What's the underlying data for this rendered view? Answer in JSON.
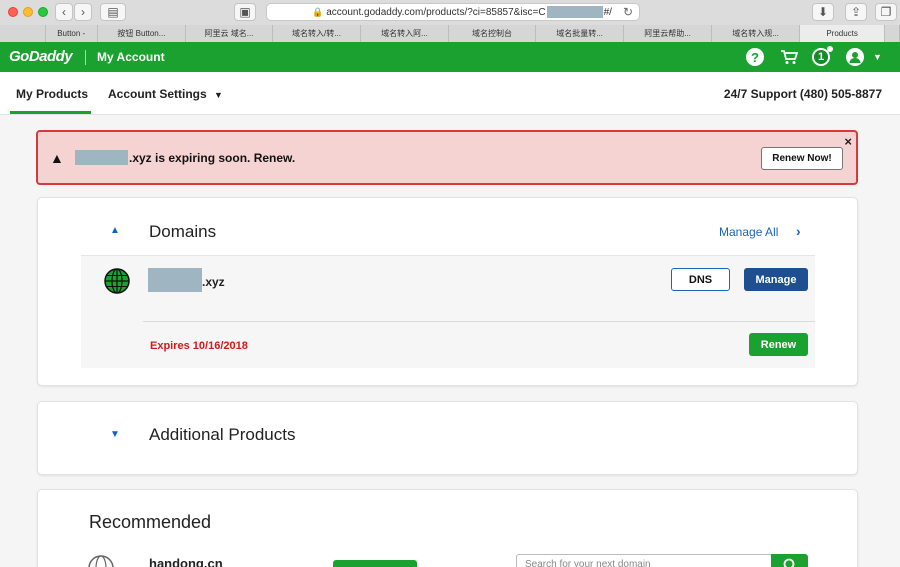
{
  "browser": {
    "url_prefix": "account.godaddy.com/products/?ci=85857&isc=C",
    "url_suffix": "#/",
    "tabs": [
      {
        "label": "",
        "active": false
      },
      {
        "label": "Button -",
        "active": false
      },
      {
        "label": "按钮 Button...",
        "active": false
      },
      {
        "label": "阿里云 域名...",
        "active": false
      },
      {
        "label": "域名转入/转...",
        "active": false
      },
      {
        "label": "域名转入阿...",
        "active": false
      },
      {
        "label": "域名控制台",
        "active": false
      },
      {
        "label": "域名批量转...",
        "active": false
      },
      {
        "label": "阿里云帮助...",
        "active": false
      },
      {
        "label": "域名转入规...",
        "active": false
      },
      {
        "label": "Products",
        "active": true
      },
      {
        "label": "",
        "active": false
      }
    ]
  },
  "header": {
    "logo": "GoDaddy",
    "account_label": "My Account",
    "help_icon": "?",
    "notification_count": "1",
    "brand_color": "#1ba12f"
  },
  "subnav": {
    "my_products": "My Products",
    "account_settings": "Account Settings",
    "support": "24/7 Support (480) 505-8877"
  },
  "alert": {
    "message": ".xyz is expiring soon. Renew.",
    "renew_now": "Renew Now!",
    "close": "×"
  },
  "domains": {
    "title": "Domains",
    "manage_all": "Manage All",
    "domain_suffix": ".xyz",
    "dns_label": "DNS",
    "manage_label": "Manage",
    "expires": "Expires 10/16/2018",
    "renew_label": "Renew"
  },
  "additional": {
    "title": "Additional Products"
  },
  "recommended": {
    "title": "Recommended",
    "domain": "handong.cn",
    "search_placeholder": "Search for your next domain"
  }
}
